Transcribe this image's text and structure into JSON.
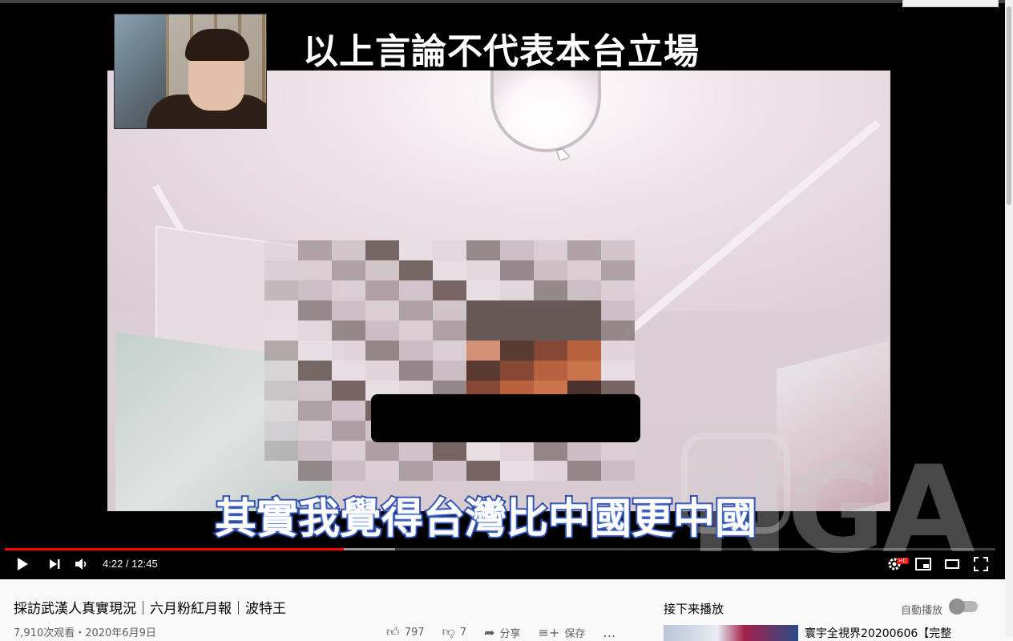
{
  "video": {
    "top_caption": "以上言論不代表本台立場",
    "bottom_caption": "其實我覺得台灣比中國更中國",
    "watermark": "NGA"
  },
  "controls": {
    "current_time": "4:22",
    "duration": "12:45",
    "time_text": "4:22 / 12:45",
    "progress_fraction": 0.342,
    "buffer_fraction": 0.394,
    "hd_badge": "HD",
    "icons": [
      "play-icon",
      "next-icon",
      "volume-icon",
      "settings-icon",
      "miniplayer-icon",
      "theater-icon",
      "fullscreen-icon"
    ]
  },
  "info": {
    "title": "採訪武漢人真實現況｜六月粉紅月報｜波特王",
    "meta": "7,910次观看・2020年6月9日",
    "likes": "797",
    "dislikes": "7",
    "share_label": "分享",
    "save_label": "保存",
    "more_label": "…"
  },
  "sidebar": {
    "up_next_label": "接下来播放",
    "autoplay_label": "自動播放",
    "related": [
      {
        "title": "寰宇全視界20200606【完整"
      }
    ]
  },
  "colors": {
    "progress": "#ff0000",
    "caption_stroke": "#1d3d99",
    "hd_badge": "#ff0000"
  }
}
